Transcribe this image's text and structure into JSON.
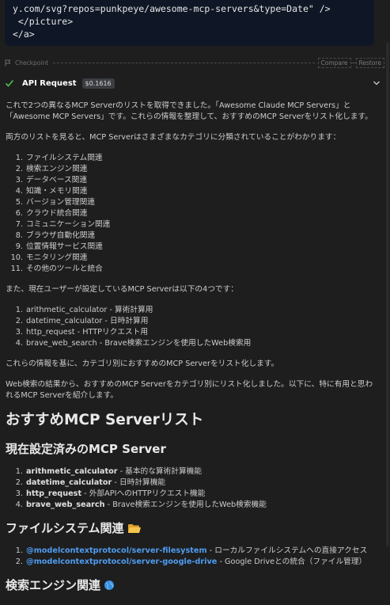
{
  "code_block": {
    "lines": [
      "y.com/svg?repos=punkpeye/awesome-mcp-servers&type=Date\" />",
      " </picture>",
      "</a>"
    ]
  },
  "checkpoint": {
    "label": "Checkpoint",
    "compare": "Compare",
    "restore": "Restore"
  },
  "api_request": {
    "title": "API Request",
    "cost": "$0.1616"
  },
  "message": {
    "intro": "これで2つの異なるMCP Serverのリストを取得できました。「Awesome Claude MCP Servers」と「Awesome MCP Servers」です。これらの情報を整理して、おすすめのMCP Serverをリスト化します。",
    "categories_intro": "両方のリストを見ると、MCP Serverはさまざまなカテゴリに分類されていることがわかります：",
    "categories": [
      "ファイルシステム関連",
      "検索エンジン関連",
      "データベース関連",
      "知識・メモリ関連",
      "バージョン管理関連",
      "クラウド統合関連",
      "コミュニケーション関連",
      "ブラウザ自動化関連",
      "位置情報サービス関連",
      "モニタリング関連",
      "その他のツールと統合"
    ],
    "current_intro": "また、現在ユーザーが設定しているMCP Serverは以下の4つです：",
    "current_servers": [
      "arithmetic_calculator - 算術計算用",
      "datetime_calculator - 日時計算用",
      "http_request - HTTPリクエスト用",
      "brave_web_search - Brave検索エンジンを使用したWeb検索用"
    ],
    "plan": "これらの情報を基に、カテゴリ別におすすめのMCP Serverをリスト化します。",
    "result": "Web検索の結果から、おすすめのMCP Serverをカテゴリ別にリスト化しました。以下に、特に有用と思われるMCP Serverを紹介します。"
  },
  "doc": {
    "h1": "おすすめMCP Serverリスト",
    "configured_heading": "現在設定済みのMCP Server",
    "configured": [
      {
        "name": "arithmetic_calculator",
        "desc": " - 基本的な算術計算機能"
      },
      {
        "name": "datetime_calculator",
        "desc": " - 日時計算機能"
      },
      {
        "name": "http_request",
        "desc": " - 外部APIへのHTTPリクエスト機能"
      },
      {
        "name": "brave_web_search",
        "desc": " - Brave検索エンジンを使用したWeb検索機能"
      }
    ],
    "fs_heading": "ファイルシステム関連",
    "fs_items": [
      {
        "name": "@modelcontextprotocol/server-filesystem",
        "desc": " - ローカルファイルシステムへの直接アクセス"
      },
      {
        "name": "@modelcontextprotocol/server-google-drive",
        "desc": " - Google Driveとの統合（ファイル管理）"
      }
    ],
    "search_heading": "検索エンジン関連"
  },
  "colors": {
    "background": "#1e1e1e",
    "code_bg": "#0f1726",
    "link": "#4f9cf0",
    "check": "#4ec04e"
  },
  "icons": [
    "flag-icon",
    "check-icon",
    "chevron-down-icon",
    "folder-icon",
    "globe-icon"
  ]
}
